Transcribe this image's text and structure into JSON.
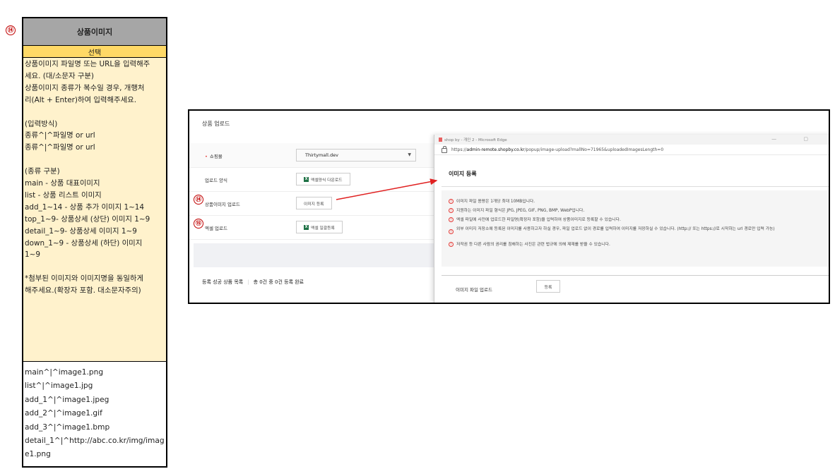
{
  "markers": {
    "m14": "⑭",
    "m15": "⑮"
  },
  "spec_card": {
    "header": "상품이미지",
    "selector": "선택",
    "description_lines": [
      "상품이미지 파일명 또는 URL을 입력해주",
      "세요. (대/소문자 구분)",
      "상품이미지 종류가 복수일 경우, 개행처",
      "리(Alt + Enter)하여 입력해주세요.",
      "",
      "(입력방식)",
      "종류^|^파일명 or url",
      "종류^|^파일명 or url",
      "",
      "(종류 구분)",
      "main - 상품 대표이미지",
      "list - 상품 리스트 이미지",
      "add_1~14 - 상품 추가 이미지 1~14",
      "top_1~9- 상품상세 (상단) 이미지 1~9",
      "detail_1~9- 상품상세 이미지 1~9",
      "down_1~9 - 상품상세 (하단) 이미지",
      "1~9",
      "",
      "*첨부된 이미지와 이미지명을 동일하게",
      "해주세요.(확장자 포함. 대소문자주의)"
    ],
    "example_lines": [
      "main^|^image1.png",
      "list^|^image1.jpg",
      "add_1^|^image1.jpeg",
      "add_2^|^image1.gif",
      "add_3^|^image1.bmp",
      "detail_1^|^http://abc.co.kr/img/image1.png"
    ]
  },
  "upload_page": {
    "title": "상품 업로드",
    "rows": [
      {
        "label": "쇼핑몰",
        "required": "•",
        "value": "Thirtymall.dev",
        "caret": "▼"
      },
      {
        "label": "업로드 양식",
        "button": "엑셀양식 다운로드",
        "excel_icon": "X"
      },
      {
        "label": "상품이미지 업로드",
        "button": "이미지 등록"
      },
      {
        "label": "엑셀 업로드",
        "button": "엑셀 일괄등록",
        "excel_icon": "X"
      }
    ],
    "result": {
      "label": "등록 성공 상품 목록",
      "text": "총 0건 중 0건 등록 완료"
    }
  },
  "popup": {
    "window_title": "shop by - 개인 2 - Microsoft Edge",
    "window_controls": "—  ▢",
    "url_prefix": "https://",
    "url_domain": "admin-remote.shopby.co.kr",
    "url_path": "/popup/image-upload?mallNo=71965&uploadedImagesLength=0",
    "heading": "이미지 등록",
    "notice_icon": "!",
    "notices": [
      "이미지 파일 용량은 1개당 최대 10MB입니다.",
      "지원하는 이미지 파일 형식은 JPG, JPEG, GIF, PNG, BMP, WebP입니다.",
      "엑셀 파일에 사전에 업로드한 파일명(확장자 포함)을 입력하여 상품이미지로 등록할 수 있습니다.",
      "외부 이미지 저장소에 등록된 이미지를 사용하고자 하실 경우, 파일 업로드 없이 경로를 입력하여 이미지를 저장하실 수 있습니다. (http:// 또는 https://로 시작하는 url 경로만 입력 가능)",
      "저작권 등 다른 사람의 권리를 침해하는 사진은 관련 법규에 의해 제재를 받을 수 있습니다."
    ],
    "file_upload": {
      "label": "이미지 파일 업로드",
      "button": "등록"
    }
  },
  "colors": {
    "marker_red": "#c00000",
    "arrow_red": "#e02020",
    "header_gray": "#a6a6a6",
    "selector_yellow": "#ffd966",
    "desc_yellow": "#fff2cc",
    "excel_green": "#1e7145"
  }
}
